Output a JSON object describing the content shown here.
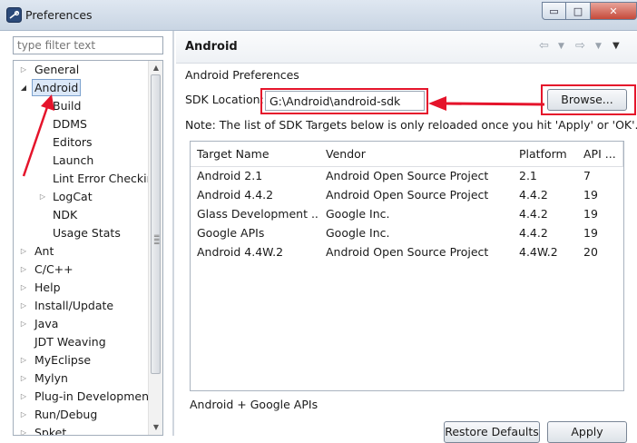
{
  "window": {
    "title": "Preferences",
    "controls": {
      "minimize": "▭",
      "maximize": "□",
      "close": "✕"
    }
  },
  "sidebar": {
    "filter_placeholder": "type filter text",
    "items": [
      {
        "label": "General",
        "expander": "▷"
      },
      {
        "label": "Android",
        "expander": "◢"
      },
      {
        "label": "Build",
        "expander": ""
      },
      {
        "label": "DDMS",
        "expander": ""
      },
      {
        "label": "Editors",
        "expander": ""
      },
      {
        "label": "Launch",
        "expander": ""
      },
      {
        "label": "Lint Error Checking",
        "expander": ""
      },
      {
        "label": "LogCat",
        "expander": "▷"
      },
      {
        "label": "NDK",
        "expander": ""
      },
      {
        "label": "Usage Stats",
        "expander": ""
      },
      {
        "label": "Ant",
        "expander": "▷"
      },
      {
        "label": "C/C++",
        "expander": "▷"
      },
      {
        "label": "Help",
        "expander": "▷"
      },
      {
        "label": "Install/Update",
        "expander": "▷"
      },
      {
        "label": "Java",
        "expander": "▷"
      },
      {
        "label": "JDT Weaving",
        "expander": ""
      },
      {
        "label": "MyEclipse",
        "expander": "▷"
      },
      {
        "label": "Mylyn",
        "expander": "▷"
      },
      {
        "label": "Plug-in Development",
        "expander": "▷"
      },
      {
        "label": "Run/Debug",
        "expander": "▷"
      },
      {
        "label": "Spket",
        "expander": "▷"
      }
    ]
  },
  "header": {
    "title": "Android"
  },
  "content": {
    "section_title": "Android Preferences",
    "sdk_label": "SDK Location:",
    "sdk_value": "G:\\Android\\android-sdk",
    "browse_label": "Browse...",
    "note": "Note: The list of SDK Targets below is only reloaded once you hit 'Apply' or 'OK'.",
    "table": {
      "headers": [
        "Target Name",
        "Vendor",
        "Platform",
        "API ..."
      ],
      "rows": [
        [
          "Android 2.1",
          "Android Open Source Project",
          "2.1",
          "7"
        ],
        [
          "Android 4.4.2",
          "Android Open Source Project",
          "4.4.2",
          "19"
        ],
        [
          "Glass Development ...",
          "Google Inc.",
          "4.4.2",
          "19"
        ],
        [
          "Google APIs",
          "Google Inc.",
          "4.4.2",
          "19"
        ],
        [
          "Android 4.4W.2",
          "Android Open Source Project",
          "4.4W.2",
          "20"
        ]
      ]
    },
    "summary": "Android + Google APIs",
    "restore_label": "Restore Defaults",
    "apply_label": "Apply"
  },
  "colors": {
    "highlight": "#e5142b",
    "selection": "#dbe8f8"
  }
}
